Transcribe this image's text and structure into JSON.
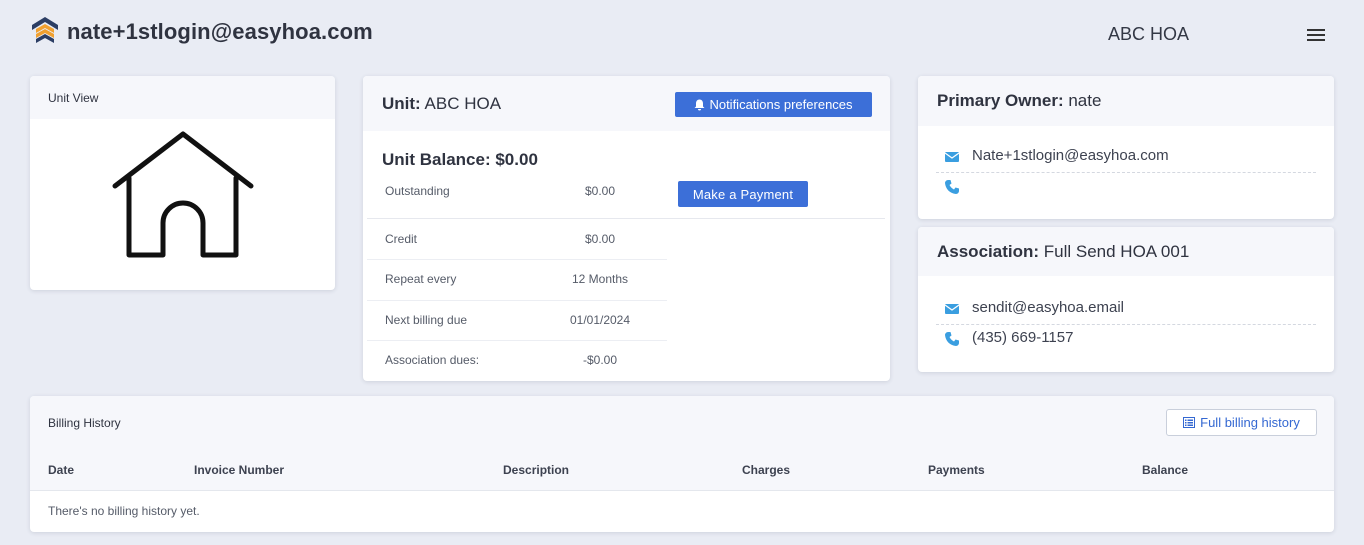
{
  "header": {
    "logo_icon": "easyhoa-logo-icon",
    "account_email": "nate+1stlogin@easyhoa.com",
    "hoa_name": "ABC HOA",
    "menu_icon": "hamburger-menu-icon"
  },
  "unit_view": {
    "title": "Unit View",
    "image_icon": "house-icon"
  },
  "unit": {
    "title_label": "Unit:",
    "title_value": "ABC HOA",
    "notifications_label": "Notifications preferences",
    "notifications_icon": "bell-icon",
    "balance_title": "Unit Balance: $0.00",
    "pay_button": "Make a Payment",
    "rows": [
      {
        "label": "Outstanding",
        "value": "$0.00"
      },
      {
        "label": "Credit",
        "value": "$0.00"
      },
      {
        "label": "Repeat every",
        "value": "12 Months"
      },
      {
        "label": "Next billing due",
        "value": "01/01/2024"
      },
      {
        "label": "Association dues:",
        "value": "-$0.00"
      }
    ]
  },
  "owner": {
    "title_label": "Primary Owner:",
    "title_value": "nate",
    "email": "Nate+1stlogin@easyhoa.com",
    "phone": ""
  },
  "association": {
    "title_label": "Association:",
    "title_value": "Full Send HOA 001",
    "email": "sendit@easyhoa.email",
    "phone": "(435) 669-1157"
  },
  "billing": {
    "title": "Billing History",
    "full_history_label": "Full billing history",
    "full_history_icon": "list-icon",
    "columns": [
      "Date",
      "Invoice Number",
      "Description",
      "Charges",
      "Payments",
      "Balance"
    ],
    "empty_message": "There's no billing history yet."
  },
  "colors": {
    "background": "#e9ecf4",
    "primary_button": "#3c6fd8",
    "icon_blue": "#3a9ee0",
    "link_blue": "#3468d2",
    "logo_orange": "#f0a030",
    "logo_navy": "#2c3e64"
  }
}
